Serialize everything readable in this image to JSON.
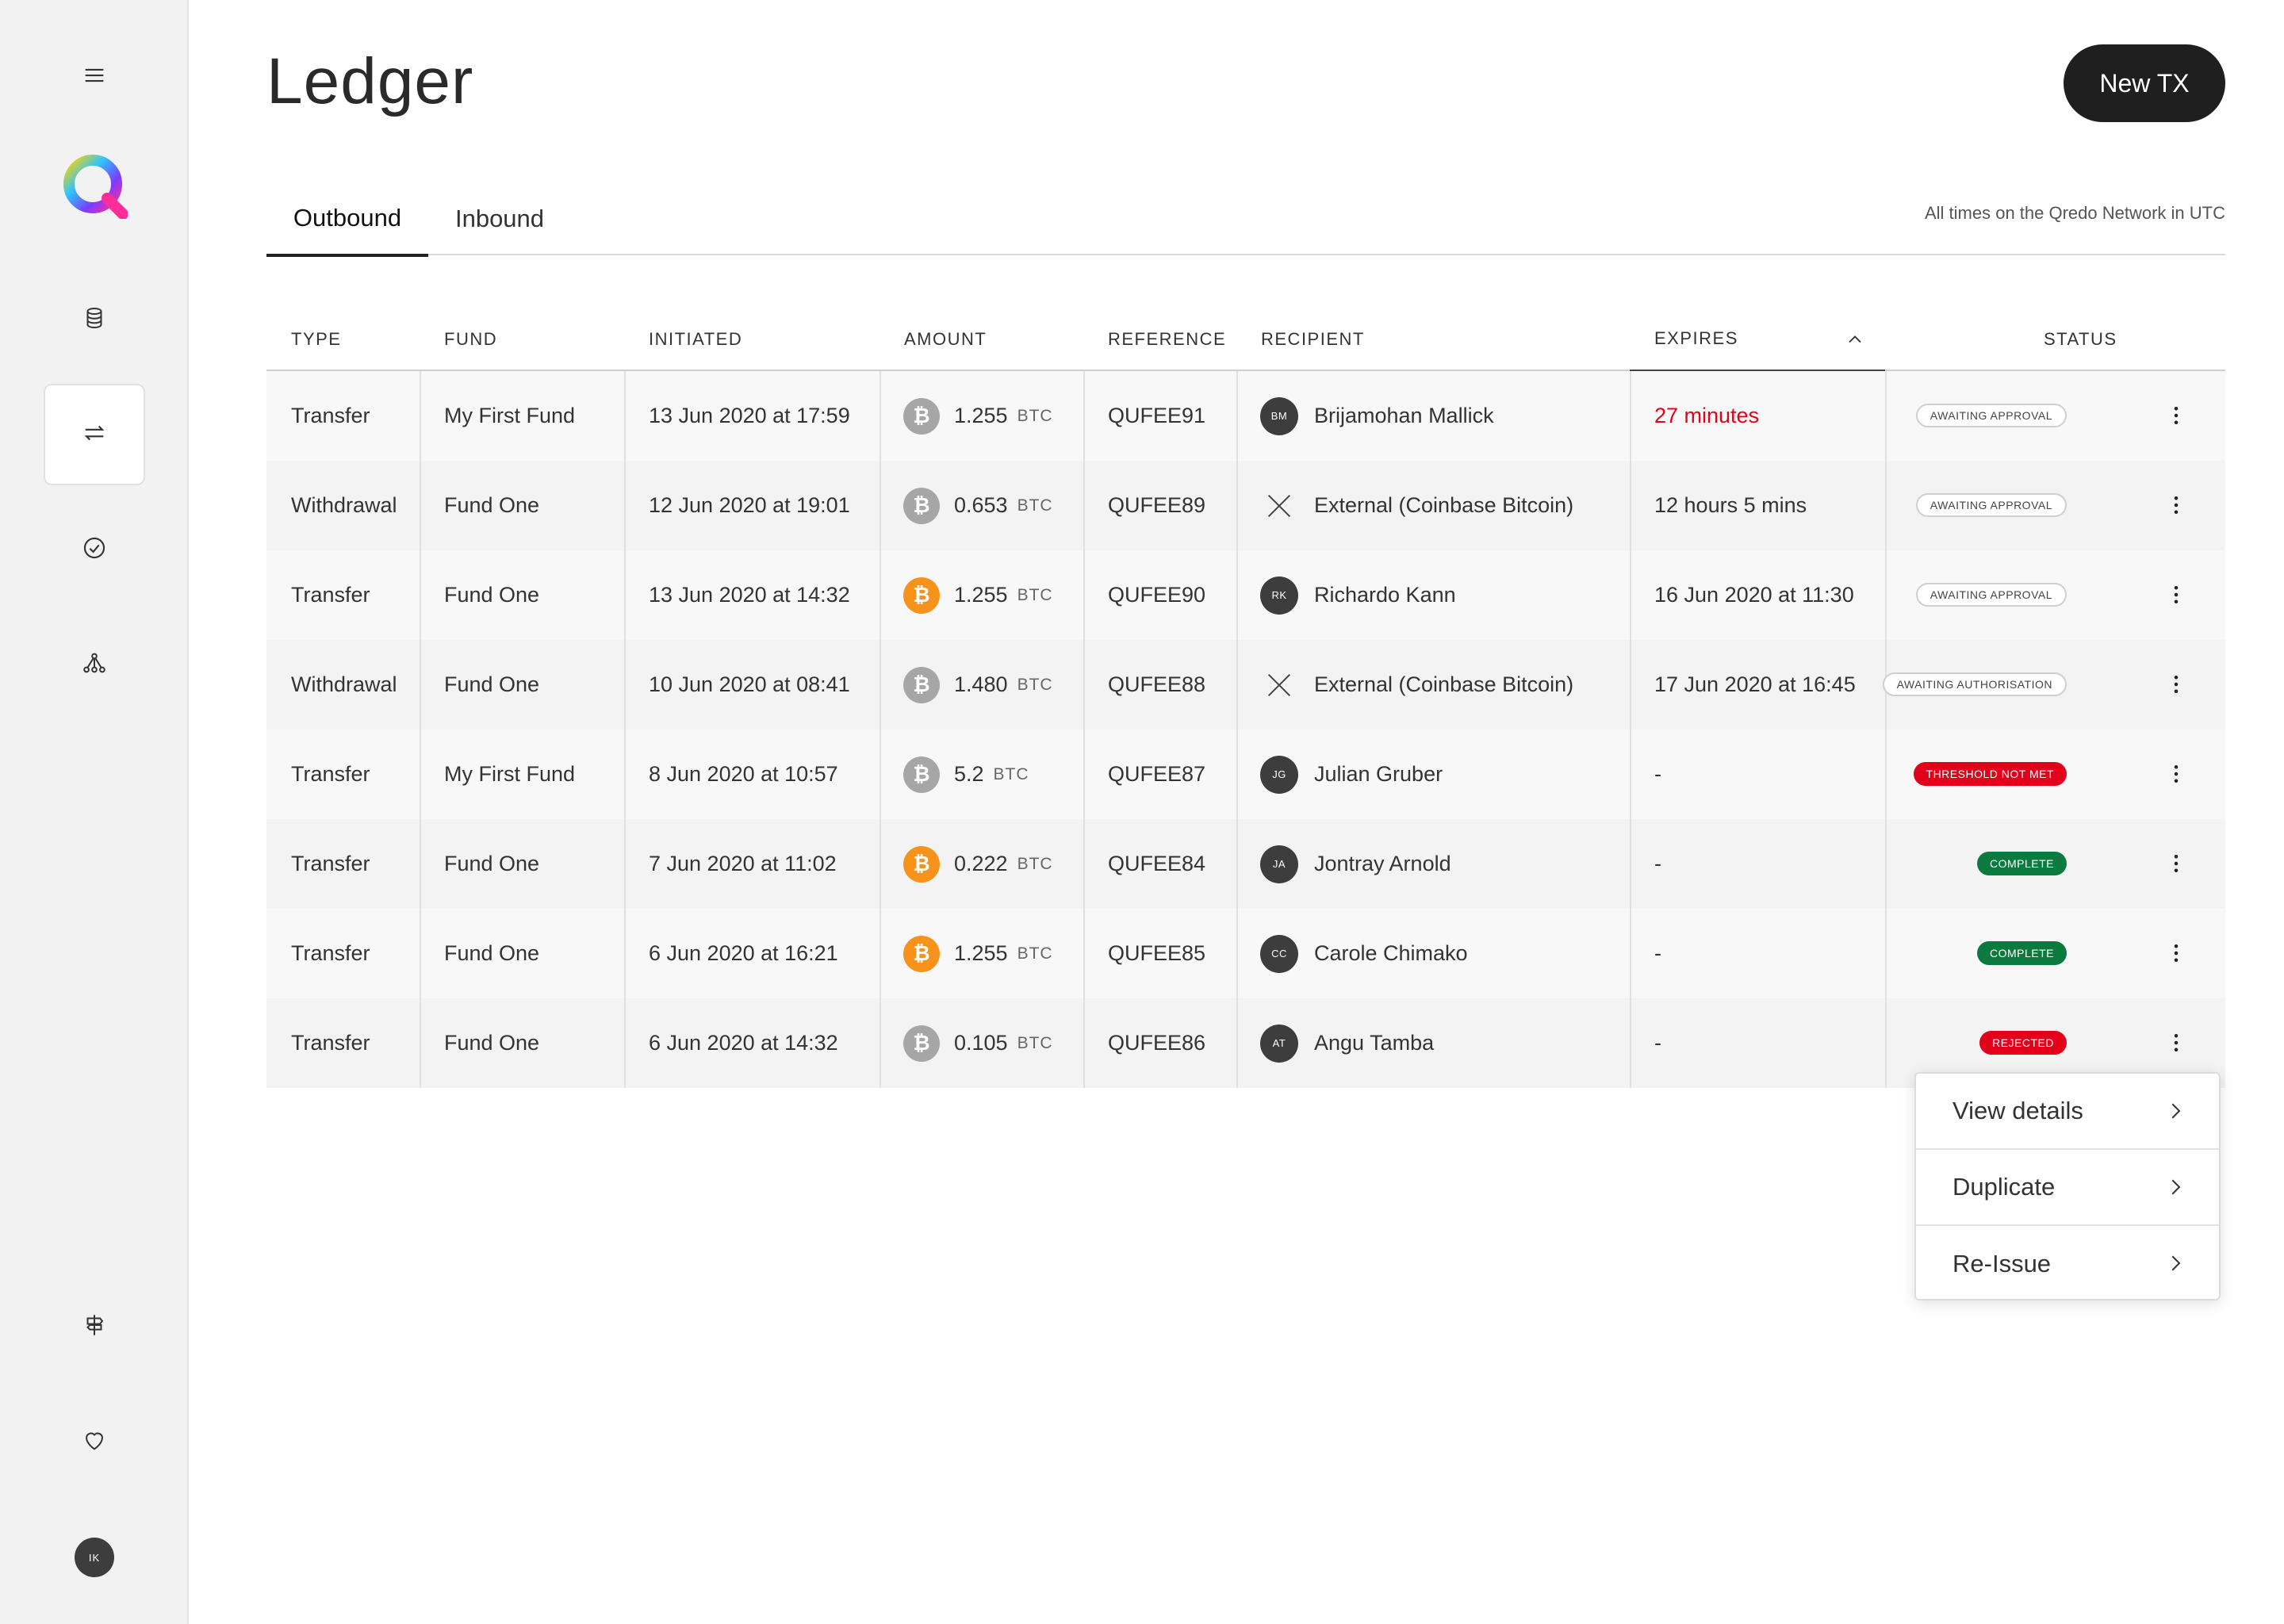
{
  "header": {
    "title": "Ledger",
    "new_tx_label": "New TX"
  },
  "tabs": [
    {
      "label": "Outbound",
      "active": true
    },
    {
      "label": "Inbound",
      "active": false
    }
  ],
  "timezone_note": "All times on the Qredo Network in UTC",
  "sidebar": {
    "items": [
      {
        "icon": "menu-icon"
      },
      {
        "icon": "qredo-logo"
      },
      {
        "icon": "database-icon"
      },
      {
        "icon": "transfer-arrows-icon",
        "active": true
      },
      {
        "icon": "check-circle-icon"
      },
      {
        "icon": "network-icon"
      },
      {
        "icon": "signpost-icon"
      },
      {
        "icon": "heart-icon"
      }
    ],
    "user_initials": "IK"
  },
  "table": {
    "columns": [
      "TYPE",
      "FUND",
      "INITIATED",
      "AMOUNT",
      "REFERENCE",
      "RECIPIENT",
      "EXPIRES",
      "STATUS"
    ],
    "sorted_column": "EXPIRES",
    "rows": [
      {
        "type": "Transfer",
        "fund": "My First Fund",
        "initiated": "13 Jun 2020 at 17:59",
        "amount": "1.255",
        "unit": "BTC",
        "coin": "grey",
        "reference": "QUFEE91",
        "recipient_initials": "BM",
        "recipient": "Brijamohan Mallick",
        "external": false,
        "expires": "27 minutes",
        "expires_urgent": true,
        "status": "AWAITING APPROVAL",
        "status_style": "outline"
      },
      {
        "type": "Withdrawal",
        "fund": "Fund One",
        "initiated": "12 Jun 2020 at 19:01",
        "amount": "0.653",
        "unit": "BTC",
        "coin": "grey",
        "reference": "QUFEE89",
        "recipient_initials": "",
        "recipient": "External (Coinbase Bitcoin)",
        "external": true,
        "expires": "12 hours 5 mins",
        "expires_urgent": false,
        "status": "AWAITING APPROVAL",
        "status_style": "outline"
      },
      {
        "type": "Transfer",
        "fund": "Fund One",
        "initiated": "13 Jun 2020 at 14:32",
        "amount": "1.255",
        "unit": "BTC",
        "coin": "orange",
        "reference": "QUFEE90",
        "recipient_initials": "RK",
        "recipient": "Richardo Kann",
        "external": false,
        "expires": "16 Jun 2020 at 11:30",
        "expires_urgent": false,
        "status": "AWAITING APPROVAL",
        "status_style": "outline"
      },
      {
        "type": "Withdrawal",
        "fund": "Fund One",
        "initiated": "10 Jun 2020 at 08:41",
        "amount": "1.480",
        "unit": "BTC",
        "coin": "grey",
        "reference": "QUFEE88",
        "recipient_initials": "",
        "recipient": "External (Coinbase Bitcoin)",
        "external": true,
        "expires": "17 Jun 2020 at 16:45",
        "expires_urgent": false,
        "status": "AWAITING AUTHORISATION",
        "status_style": "outline"
      },
      {
        "type": "Transfer",
        "fund": "My First Fund",
        "initiated": "8 Jun 2020 at 10:57",
        "amount": "5.2",
        "unit": "BTC",
        "coin": "grey",
        "reference": "QUFEE87",
        "recipient_initials": "JG",
        "recipient": "Julian Gruber",
        "external": false,
        "expires": "-",
        "expires_urgent": false,
        "status": "THRESHOLD NOT MET",
        "status_style": "red"
      },
      {
        "type": "Transfer",
        "fund": "Fund One",
        "initiated": "7 Jun 2020 at 11:02",
        "amount": "0.222",
        "unit": "BTC",
        "coin": "orange",
        "reference": "QUFEE84",
        "recipient_initials": "JA",
        "recipient": "Jontray Arnold",
        "external": false,
        "expires": "-",
        "expires_urgent": false,
        "status": "COMPLETE",
        "status_style": "green"
      },
      {
        "type": "Transfer",
        "fund": "Fund One",
        "initiated": "6 Jun 2020 at 16:21",
        "amount": "1.255",
        "unit": "BTC",
        "coin": "orange",
        "reference": "QUFEE85",
        "recipient_initials": "CC",
        "recipient": "Carole Chimako",
        "external": false,
        "expires": "-",
        "expires_urgent": false,
        "status": "COMPLETE",
        "status_style": "green"
      },
      {
        "type": "Transfer",
        "fund": "Fund One",
        "initiated": "6 Jun 2020 at 14:32",
        "amount": "0.105",
        "unit": "BTC",
        "coin": "grey",
        "reference": "QUFEE86",
        "recipient_initials": "AT",
        "recipient": "Angu Tamba",
        "external": false,
        "expires": "-",
        "expires_urgent": false,
        "status": "REJECTED",
        "status_style": "red"
      }
    ]
  },
  "context_menu": {
    "items": [
      {
        "label": "View details"
      },
      {
        "label": "Duplicate"
      },
      {
        "label": "Re-Issue"
      }
    ]
  },
  "colors": {
    "accent_red": "#e3001b",
    "complete_green": "#0b7a3e",
    "btc_orange": "#f7931a",
    "btc_grey": "#a6a6a6"
  }
}
